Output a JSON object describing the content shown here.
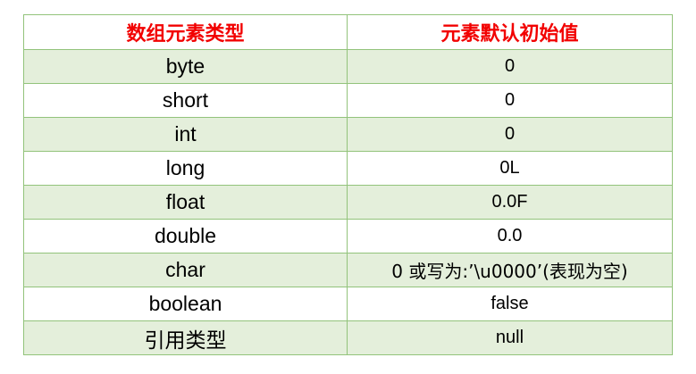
{
  "table": {
    "headers": [
      "数组元素类型",
      "元素默认初始值"
    ],
    "rows": [
      {
        "type": "byte",
        "default": "0"
      },
      {
        "type": "short",
        "default": "0"
      },
      {
        "type": "int",
        "default": "0"
      },
      {
        "type": "long",
        "default": "0L"
      },
      {
        "type": "float",
        "default": "0.0F"
      },
      {
        "type": "double",
        "default": "0.0"
      },
      {
        "type": "char",
        "default": "0 或写为:’\\u0000’(表现为空)"
      },
      {
        "type": "boolean",
        "default": "false"
      },
      {
        "type": "引用类型",
        "default": "null"
      }
    ]
  },
  "colors": {
    "header_text": "#F20000",
    "border": "#92C37B",
    "row_stripe": "#E4EFDB",
    "row_plain": "#FFFFFF"
  }
}
